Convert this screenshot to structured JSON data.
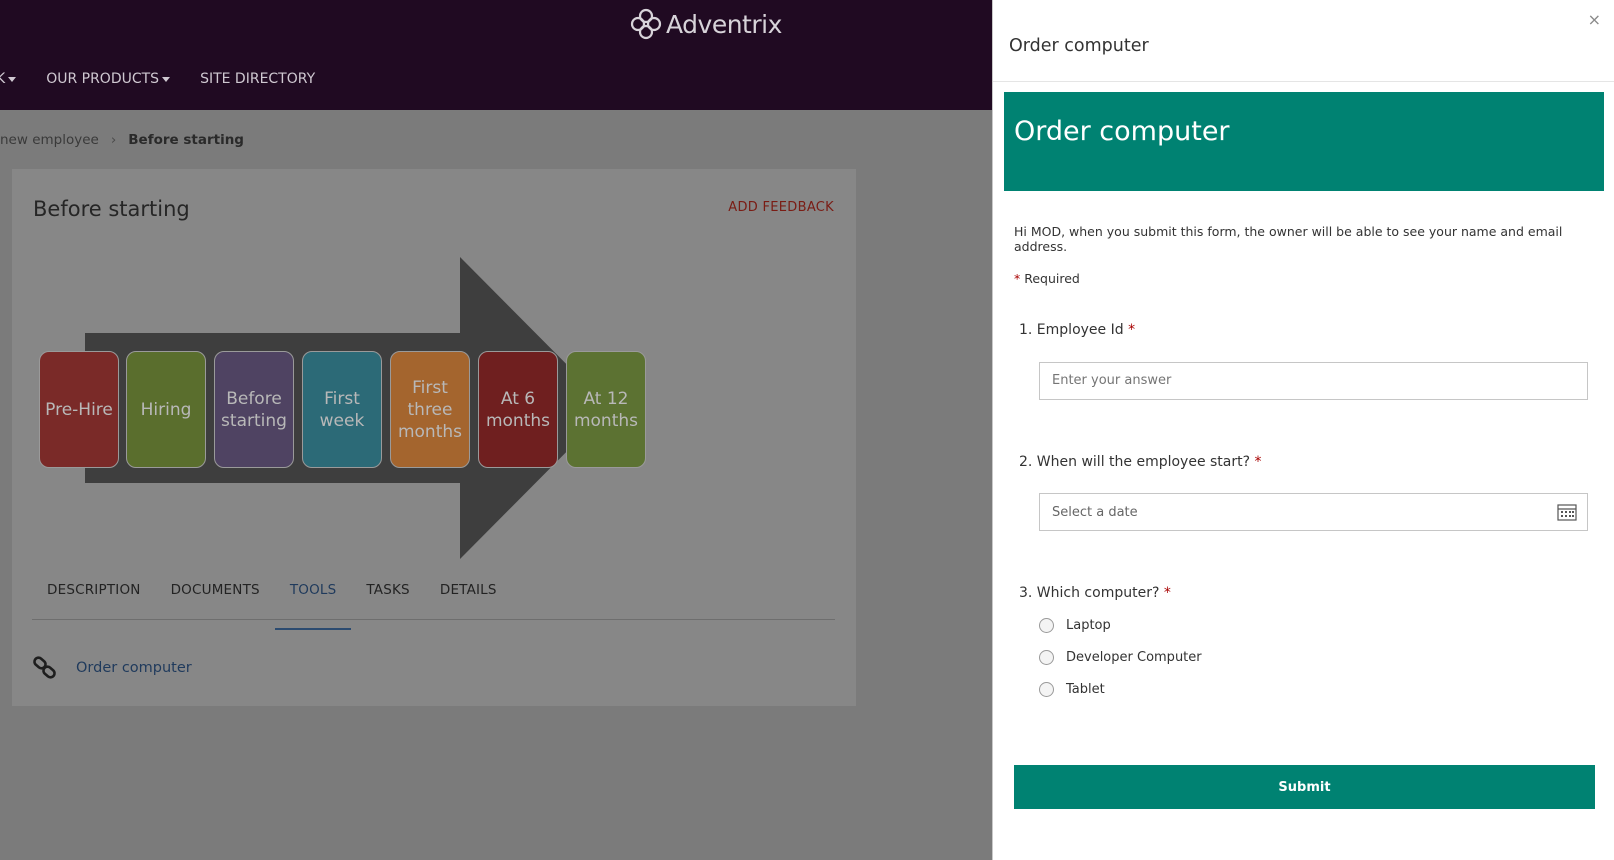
{
  "brand": {
    "name": "Adventrix"
  },
  "nav": {
    "partial_item": "K",
    "items": [
      {
        "label": "OUR PRODUCTS"
      },
      {
        "label": "SITE DIRECTORY"
      }
    ]
  },
  "breadcrumb": {
    "parent": "new employee",
    "separator": "›",
    "current": "Before starting"
  },
  "card": {
    "title": "Before starting",
    "add_feedback": "ADD FEEDBACK",
    "process_steps": [
      {
        "label": "Pre-Hire",
        "color": "#7a2a28"
      },
      {
        "label": "Hiring",
        "color": "#5a6e2d"
      },
      {
        "label": "Before starting",
        "color": "#4f4362"
      },
      {
        "label": "First week",
        "color": "#2c6a77"
      },
      {
        "label": "First three months",
        "color": "#a4652e"
      },
      {
        "label": "At 6 months",
        "color": "#6f1f1f"
      },
      {
        "label": "At 12 months",
        "color": "#5c7232"
      }
    ],
    "tabs": [
      {
        "label": "DESCRIPTION",
        "active": false
      },
      {
        "label": "DOCUMENTS",
        "active": false
      },
      {
        "label": "TOOLS",
        "active": true
      },
      {
        "label": "TASKS",
        "active": false
      },
      {
        "label": "DETAILS",
        "active": false
      }
    ],
    "tool_link": "Order computer"
  },
  "panel": {
    "title": "Order computer",
    "close": "×",
    "form": {
      "title": "Order computer",
      "notice": "Hi MOD, when you submit this form, the owner will be able to see your name and email address.",
      "required_label": "Required",
      "required_marker": "*",
      "q1": {
        "label": "1. Employee Id",
        "placeholder": "Enter your answer"
      },
      "q2": {
        "label": "2. When will the employee start?",
        "placeholder": "Select a date"
      },
      "q3": {
        "label": "3. Which computer?",
        "options": [
          "Laptop",
          "Developer Computer",
          "Tablet"
        ]
      },
      "submit": "Submit"
    }
  },
  "colors": {
    "header": "#200a22",
    "form_accent": "#008272",
    "required": "#a80000",
    "feedback": "#7a1c14"
  }
}
